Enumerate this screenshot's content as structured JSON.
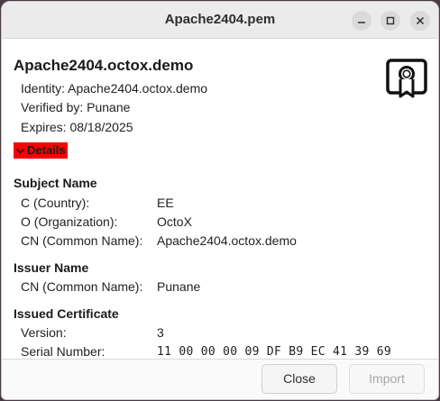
{
  "window": {
    "title": "Apache2404.pem"
  },
  "certificate": {
    "title": "Apache2404.octox.demo",
    "identity": "Identity: Apache2404.octox.demo",
    "verified_by": "Verified by: Punane",
    "expires": "Expires: 08/18/2025",
    "details_label": "Details"
  },
  "subject": {
    "heading": "Subject Name",
    "fields": [
      {
        "label": "C (Country):",
        "value": "EE"
      },
      {
        "label": "O (Organization):",
        "value": "OctoX"
      },
      {
        "label": "CN (Common Name):",
        "value": "Apache2404.octox.demo"
      }
    ]
  },
  "issuer": {
    "heading": "Issuer Name",
    "fields": [
      {
        "label": "CN (Common Name):",
        "value": "Punane"
      }
    ]
  },
  "issued": {
    "heading": "Issued Certificate",
    "fields": [
      {
        "label": "Version:",
        "value": "3"
      },
      {
        "label": "Serial Number:",
        "value": "11 00 00 00 09 DF B9 EC 41 39 69"
      }
    ]
  },
  "footer": {
    "close_label": "Close",
    "import_label": "Import"
  },
  "colors": {
    "details_highlight": "#ff0000"
  }
}
